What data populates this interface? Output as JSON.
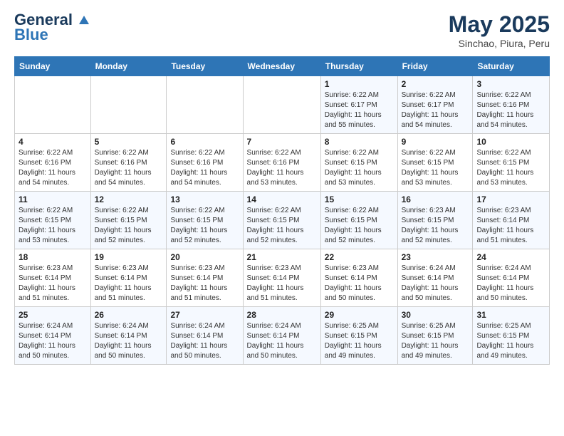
{
  "header": {
    "logo_line1": "General",
    "logo_line2": "Blue",
    "month": "May 2025",
    "location": "Sinchao, Piura, Peru"
  },
  "days_of_week": [
    "Sunday",
    "Monday",
    "Tuesday",
    "Wednesday",
    "Thursday",
    "Friday",
    "Saturday"
  ],
  "weeks": [
    [
      {
        "day": "",
        "info": ""
      },
      {
        "day": "",
        "info": ""
      },
      {
        "day": "",
        "info": ""
      },
      {
        "day": "",
        "info": ""
      },
      {
        "day": "1",
        "info": "Sunrise: 6:22 AM\nSunset: 6:17 PM\nDaylight: 11 hours\nand 55 minutes."
      },
      {
        "day": "2",
        "info": "Sunrise: 6:22 AM\nSunset: 6:17 PM\nDaylight: 11 hours\nand 54 minutes."
      },
      {
        "day": "3",
        "info": "Sunrise: 6:22 AM\nSunset: 6:16 PM\nDaylight: 11 hours\nand 54 minutes."
      }
    ],
    [
      {
        "day": "4",
        "info": "Sunrise: 6:22 AM\nSunset: 6:16 PM\nDaylight: 11 hours\nand 54 minutes."
      },
      {
        "day": "5",
        "info": "Sunrise: 6:22 AM\nSunset: 6:16 PM\nDaylight: 11 hours\nand 54 minutes."
      },
      {
        "day": "6",
        "info": "Sunrise: 6:22 AM\nSunset: 6:16 PM\nDaylight: 11 hours\nand 54 minutes."
      },
      {
        "day": "7",
        "info": "Sunrise: 6:22 AM\nSunset: 6:16 PM\nDaylight: 11 hours\nand 53 minutes."
      },
      {
        "day": "8",
        "info": "Sunrise: 6:22 AM\nSunset: 6:15 PM\nDaylight: 11 hours\nand 53 minutes."
      },
      {
        "day": "9",
        "info": "Sunrise: 6:22 AM\nSunset: 6:15 PM\nDaylight: 11 hours\nand 53 minutes."
      },
      {
        "day": "10",
        "info": "Sunrise: 6:22 AM\nSunset: 6:15 PM\nDaylight: 11 hours\nand 53 minutes."
      }
    ],
    [
      {
        "day": "11",
        "info": "Sunrise: 6:22 AM\nSunset: 6:15 PM\nDaylight: 11 hours\nand 53 minutes."
      },
      {
        "day": "12",
        "info": "Sunrise: 6:22 AM\nSunset: 6:15 PM\nDaylight: 11 hours\nand 52 minutes."
      },
      {
        "day": "13",
        "info": "Sunrise: 6:22 AM\nSunset: 6:15 PM\nDaylight: 11 hours\nand 52 minutes."
      },
      {
        "day": "14",
        "info": "Sunrise: 6:22 AM\nSunset: 6:15 PM\nDaylight: 11 hours\nand 52 minutes."
      },
      {
        "day": "15",
        "info": "Sunrise: 6:22 AM\nSunset: 6:15 PM\nDaylight: 11 hours\nand 52 minutes."
      },
      {
        "day": "16",
        "info": "Sunrise: 6:23 AM\nSunset: 6:15 PM\nDaylight: 11 hours\nand 52 minutes."
      },
      {
        "day": "17",
        "info": "Sunrise: 6:23 AM\nSunset: 6:14 PM\nDaylight: 11 hours\nand 51 minutes."
      }
    ],
    [
      {
        "day": "18",
        "info": "Sunrise: 6:23 AM\nSunset: 6:14 PM\nDaylight: 11 hours\nand 51 minutes."
      },
      {
        "day": "19",
        "info": "Sunrise: 6:23 AM\nSunset: 6:14 PM\nDaylight: 11 hours\nand 51 minutes."
      },
      {
        "day": "20",
        "info": "Sunrise: 6:23 AM\nSunset: 6:14 PM\nDaylight: 11 hours\nand 51 minutes."
      },
      {
        "day": "21",
        "info": "Sunrise: 6:23 AM\nSunset: 6:14 PM\nDaylight: 11 hours\nand 51 minutes."
      },
      {
        "day": "22",
        "info": "Sunrise: 6:23 AM\nSunset: 6:14 PM\nDaylight: 11 hours\nand 50 minutes."
      },
      {
        "day": "23",
        "info": "Sunrise: 6:24 AM\nSunset: 6:14 PM\nDaylight: 11 hours\nand 50 minutes."
      },
      {
        "day": "24",
        "info": "Sunrise: 6:24 AM\nSunset: 6:14 PM\nDaylight: 11 hours\nand 50 minutes."
      }
    ],
    [
      {
        "day": "25",
        "info": "Sunrise: 6:24 AM\nSunset: 6:14 PM\nDaylight: 11 hours\nand 50 minutes."
      },
      {
        "day": "26",
        "info": "Sunrise: 6:24 AM\nSunset: 6:14 PM\nDaylight: 11 hours\nand 50 minutes."
      },
      {
        "day": "27",
        "info": "Sunrise: 6:24 AM\nSunset: 6:14 PM\nDaylight: 11 hours\nand 50 minutes."
      },
      {
        "day": "28",
        "info": "Sunrise: 6:24 AM\nSunset: 6:14 PM\nDaylight: 11 hours\nand 50 minutes."
      },
      {
        "day": "29",
        "info": "Sunrise: 6:25 AM\nSunset: 6:15 PM\nDaylight: 11 hours\nand 49 minutes."
      },
      {
        "day": "30",
        "info": "Sunrise: 6:25 AM\nSunset: 6:15 PM\nDaylight: 11 hours\nand 49 minutes."
      },
      {
        "day": "31",
        "info": "Sunrise: 6:25 AM\nSunset: 6:15 PM\nDaylight: 11 hours\nand 49 minutes."
      }
    ]
  ]
}
